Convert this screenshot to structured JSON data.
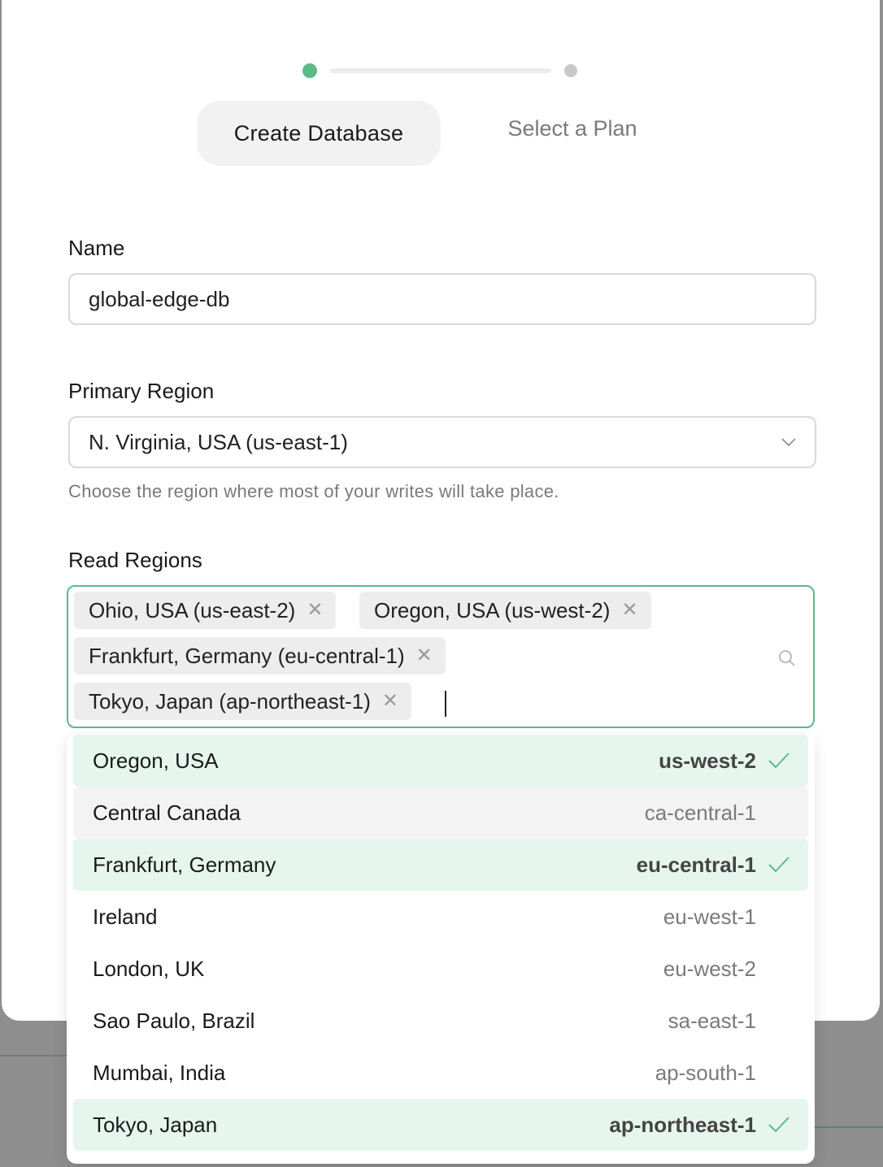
{
  "stepper": {
    "steps": [
      {
        "label": "Create Database",
        "state": "active"
      },
      {
        "label": "Select a Plan",
        "state": "inactive"
      }
    ],
    "accent_color": "#5cba8a"
  },
  "form": {
    "name_label": "Name",
    "name_value": "global-edge-db",
    "primary_region_label": "Primary Region",
    "primary_region_value": "N. Virginia, USA (us-east-1)",
    "primary_region_help": "Choose the region where most of your writes will take place.",
    "read_regions_label": "Read Regions",
    "read_regions_selected": [
      {
        "label": "Ohio, USA (us-east-2)",
        "remove_icon": "close-icon"
      },
      {
        "label": "Oregon, USA (us-west-2)",
        "remove_icon": "close-icon"
      },
      {
        "label": "Frankfurt, Germany (eu-central-1)",
        "remove_icon": "close-icon"
      },
      {
        "label": "Tokyo, Japan (ap-northeast-1)",
        "remove_icon": "close-icon"
      }
    ]
  },
  "dropdown": {
    "options": [
      {
        "name": "Oregon, USA",
        "code": "us-west-2",
        "selected": true
      },
      {
        "name": "Central Canada",
        "code": "ca-central-1",
        "selected": false,
        "hovered": true
      },
      {
        "name": "Frankfurt, Germany",
        "code": "eu-central-1",
        "selected": true
      },
      {
        "name": "Ireland",
        "code": "eu-west-1",
        "selected": false
      },
      {
        "name": "London, UK",
        "code": "eu-west-2",
        "selected": false
      },
      {
        "name": "Sao Paulo, Brazil",
        "code": "sa-east-1",
        "selected": false
      },
      {
        "name": "Mumbai, India",
        "code": "ap-south-1",
        "selected": false
      },
      {
        "name": "Tokyo, Japan",
        "code": "ap-northeast-1",
        "selected": true
      }
    ]
  }
}
